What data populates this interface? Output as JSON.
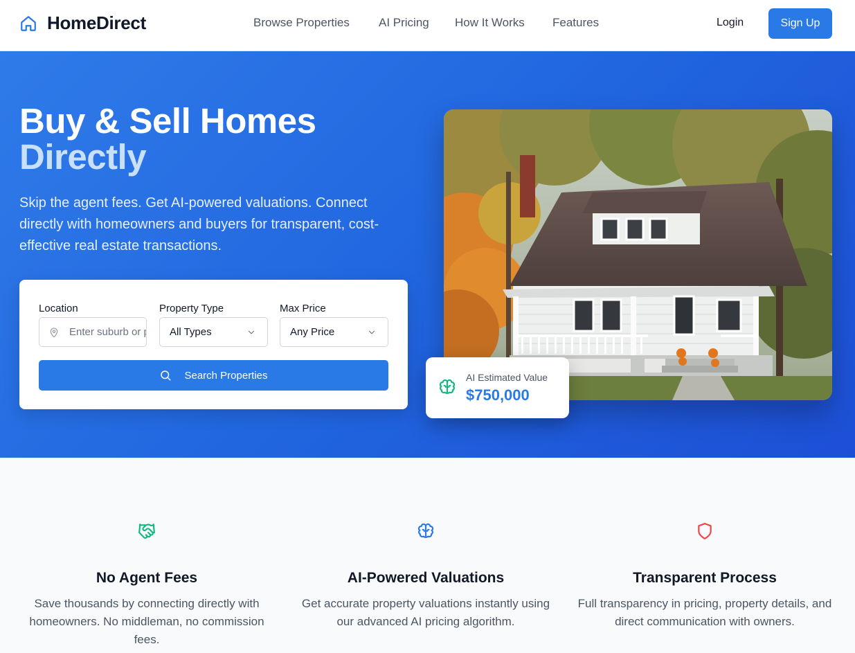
{
  "header": {
    "brand": "HomeDirect",
    "nav": [
      "Browse Properties",
      "AI Pricing",
      "How It Works",
      "Features"
    ],
    "login": "Login",
    "signup": "Sign Up"
  },
  "hero": {
    "title_line1": "Buy & Sell Homes",
    "title_line2": "Directly",
    "subtitle": "Skip the agent fees. Get AI-powered valuations. Connect directly with homeowners and buyers for transparent, cost-effective real estate transactions."
  },
  "search": {
    "location_label": "Location",
    "location_placeholder": "Enter suburb or postcode",
    "type_label": "Property Type",
    "type_value": "All Types",
    "price_label": "Max Price",
    "price_value": "Any Price",
    "button": "Search Properties"
  },
  "valuation": {
    "label": "AI Estimated Value",
    "value": "$750,000"
  },
  "features": [
    {
      "icon": "handshake-icon",
      "title": "No Agent Fees",
      "text": "Save thousands by connecting directly with homeowners. No middleman, no commission fees."
    },
    {
      "icon": "brain-icon",
      "title": "AI-Powered Valuations",
      "text": "Get accurate property valuations instantly using our advanced AI pricing algorithm."
    },
    {
      "icon": "shield-icon",
      "title": "Transparent Process",
      "text": "Full transparency in pricing, property details, and direct communication with owners."
    }
  ],
  "colors": {
    "primary": "#2979e6",
    "hero_bg": "#2166df",
    "accent_text": "#c9e0fb",
    "feature_green": "#10b981",
    "feature_blue": "#2979e6",
    "feature_red": "#ef4444"
  }
}
